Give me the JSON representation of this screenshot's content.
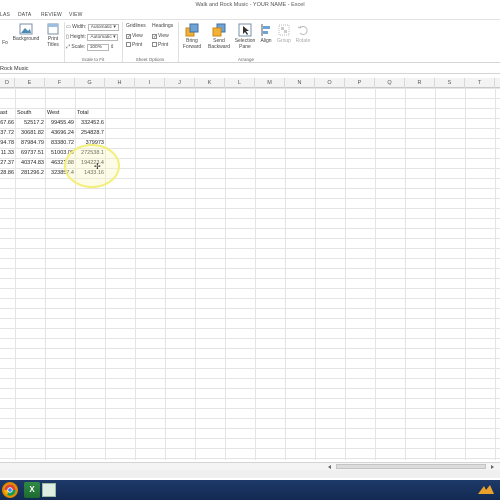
{
  "window": {
    "title": "Walk and Rock Music - YOUR NAME - Excel"
  },
  "tabs": [
    "LAS",
    "DATA",
    "REVIEW",
    "VIEW"
  ],
  "ribbon": {
    "page_setup": {
      "items": [
        "Fo",
        "Background",
        "Print Titles"
      ]
    },
    "scale_to_fit": {
      "label": "Scale to Fit",
      "width_label": "Width:",
      "width_value": "Automatic",
      "height_label": "Height:",
      "height_value": "Automatic",
      "scale_label": "Scale:",
      "scale_value": "100%"
    },
    "sheet_options": {
      "label": "Sheet Options",
      "gridlines": "Gridlines",
      "headings": "Headings",
      "view": "View",
      "print": "Print"
    },
    "arrange": {
      "label": "Arrange",
      "bring_forward": "Bring Forward",
      "send_backward": "Send Backward",
      "selection_pane": "Selection Pane",
      "align": "Align",
      "group": "Group",
      "rotate": "Rotate"
    }
  },
  "name_box": "Rock Music",
  "columns": [
    "D",
    "E",
    "F",
    "G",
    "H",
    "I",
    "J",
    "K",
    "L",
    "M",
    "N",
    "O",
    "P",
    "Q",
    "R",
    "S",
    "T"
  ],
  "table": {
    "headers": [
      "ast",
      "South",
      "West",
      "Total"
    ],
    "rows": [
      [
        "67.66",
        "52517.2",
        "99455.49",
        "332452.6"
      ],
      [
        "37.72",
        "30681.82",
        "43696.24",
        "254828.7"
      ],
      [
        "94.78",
        "87984.79",
        "83380.72",
        "379973"
      ],
      [
        "11.33",
        "69737.51",
        "51003.09",
        "272538.1"
      ],
      [
        "27.37",
        "40374.83",
        "46321.88",
        "194223.4"
      ],
      [
        "28.86",
        "281296.2",
        "323857.4",
        "1433.16"
      ]
    ]
  },
  "colors": {
    "taskbar": "#1e3a6a",
    "excel_green": "#1d6a30",
    "highlight_ring": "#f3ef7a"
  },
  "taskbar": {
    "icons": [
      "start-orb-icon",
      "chrome-icon",
      "excel-icon",
      "tray-icon"
    ]
  }
}
